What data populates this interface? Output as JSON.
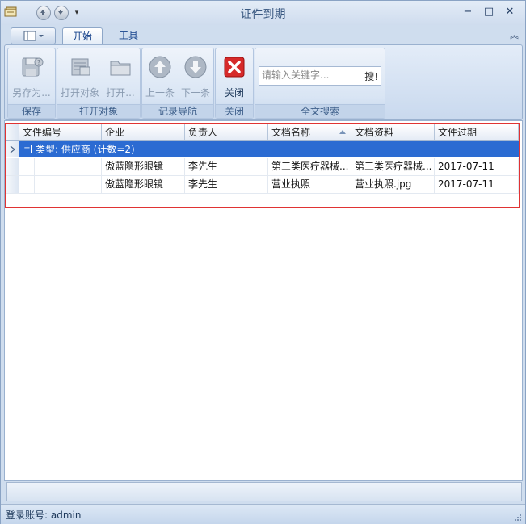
{
  "window": {
    "title": "证件到期",
    "controls": {
      "minimize": "−",
      "maximize": "□",
      "close": "✕"
    }
  },
  "tabs": [
    {
      "label": "开始",
      "active": true
    },
    {
      "label": "工具",
      "active": false
    }
  ],
  "ribbon": {
    "groups": [
      {
        "label": "保存",
        "buttons": [
          {
            "label": "另存为...",
            "icon": "save-as-icon",
            "enabled": false
          }
        ]
      },
      {
        "label": "打开对象",
        "buttons": [
          {
            "label": "打开对象",
            "icon": "open-object-icon",
            "enabled": false
          },
          {
            "label": "打开...",
            "icon": "folder-icon",
            "enabled": false
          }
        ]
      },
      {
        "label": "记录导航",
        "buttons": [
          {
            "label": "上一条",
            "icon": "arrow-up-icon",
            "enabled": false
          },
          {
            "label": "下一条",
            "icon": "arrow-down-icon",
            "enabled": false
          }
        ]
      },
      {
        "label": "关闭",
        "buttons": [
          {
            "label": "关闭",
            "icon": "close-red-icon",
            "enabled": true
          }
        ]
      },
      {
        "label": "全文搜索",
        "search": {
          "placeholder": "请输入关键字...",
          "button": "搜!"
        }
      }
    ]
  },
  "grid": {
    "columns": [
      "文件编号",
      "企业",
      "负责人",
      "文档名称",
      "文档资料",
      "文件过期"
    ],
    "sorted_column": "文档名称",
    "group": {
      "label": "类型: 供应商 (计数=2)"
    },
    "rows": [
      {
        "file_no": "",
        "company": "傲蓝隐形眼镜",
        "owner": "李先生",
        "doc_name": "第三类医疗器械...",
        "doc_file": "第三类医疗器械...",
        "expiry": "2017-07-11"
      },
      {
        "file_no": "",
        "company": "傲蓝隐形眼镜",
        "owner": "李先生",
        "doc_name": "营业执照",
        "doc_file": "营业执照.jpg",
        "expiry": "2017-07-11"
      }
    ]
  },
  "status": {
    "login": "登录账号: admin"
  },
  "colors": {
    "group_row": "#2b6bd2",
    "highlight": "#e03333"
  }
}
